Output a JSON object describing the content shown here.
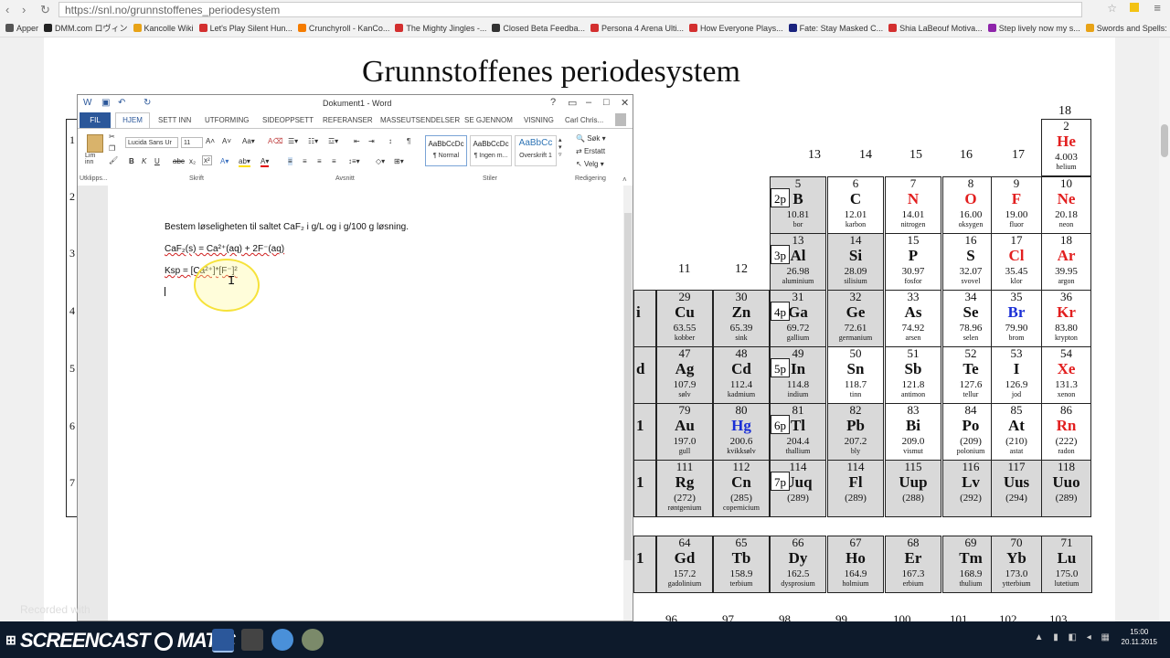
{
  "browser": {
    "url": "https://snl.no/grunnstoffenes_periodesystem",
    "bookmarks": [
      "Apper",
      "DMM.com ロヴィン",
      "Kancolle Wiki",
      "Let's Play Silent Hun...",
      "Crunchyroll - KanCo...",
      "The Mighty Jingles -...",
      "Closed Beta Feedba...",
      "Persona 4 Arena Ulti...",
      "How Everyone Plays...",
      "Fate: Stay Masked C...",
      "Shia LaBeouf Motiva...",
      "Step lively now my s...",
      "Swords and Spells: ..."
    ],
    "bookmark_colors": [
      "#555555",
      "#222222",
      "#e8a317",
      "#d32f2f",
      "#f57c00",
      "#d32f2f",
      "#333333",
      "#d32f2f",
      "#d32f2f",
      "#1a237e",
      "#d32f2f",
      "#8e24aa",
      "#e8a317"
    ]
  },
  "page": {
    "title": "Grunnstoffenes periodesystem",
    "group_numbers": {
      "g18": "18",
      "g13": "13",
      "g14": "14",
      "g15": "15",
      "g16": "16",
      "g17": "17",
      "g11": "11",
      "g12": "12"
    },
    "subshells": [
      "2p",
      "3p",
      "4p",
      "5p",
      "6p",
      "7p"
    ],
    "row_numbers": [
      "1",
      "2",
      "3",
      "4",
      "5",
      "6",
      "7"
    ],
    "elements": [
      {
        "n": "2",
        "s": "He",
        "m": "4.003",
        "name": "helium",
        "c": "red"
      },
      {
        "n": "5",
        "s": "B",
        "m": "10.81",
        "name": "bor",
        "c": ""
      },
      {
        "n": "6",
        "s": "C",
        "m": "12.01",
        "name": "karbon",
        "c": ""
      },
      {
        "n": "7",
        "s": "N",
        "m": "14.01",
        "name": "nitrogen",
        "c": "red"
      },
      {
        "n": "8",
        "s": "O",
        "m": "16.00",
        "name": "oksygen",
        "c": "red"
      },
      {
        "n": "9",
        "s": "F",
        "m": "19.00",
        "name": "fluor",
        "c": "red"
      },
      {
        "n": "10",
        "s": "Ne",
        "m": "20.18",
        "name": "neon",
        "c": "red"
      },
      {
        "n": "13",
        "s": "Al",
        "m": "26.98",
        "name": "aluminium",
        "c": ""
      },
      {
        "n": "14",
        "s": "Si",
        "m": "28.09",
        "name": "silisium",
        "c": ""
      },
      {
        "n": "15",
        "s": "P",
        "m": "30.97",
        "name": "fosfor",
        "c": ""
      },
      {
        "n": "16",
        "s": "S",
        "m": "32.07",
        "name": "svovel",
        "c": ""
      },
      {
        "n": "17",
        "s": "Cl",
        "m": "35.45",
        "name": "klor",
        "c": "red"
      },
      {
        "n": "18",
        "s": "Ar",
        "m": "39.95",
        "name": "argon",
        "c": "red"
      },
      {
        "n": "29",
        "s": "Cu",
        "m": "63.55",
        "name": "kobber",
        "c": ""
      },
      {
        "n": "30",
        "s": "Zn",
        "m": "65.39",
        "name": "sink",
        "c": ""
      },
      {
        "n": "31",
        "s": "Ga",
        "m": "69.72",
        "name": "gallium",
        "c": ""
      },
      {
        "n": "32",
        "s": "Ge",
        "m": "72.61",
        "name": "germanium",
        "c": ""
      },
      {
        "n": "33",
        "s": "As",
        "m": "74.92",
        "name": "arsen",
        "c": ""
      },
      {
        "n": "34",
        "s": "Se",
        "m": "78.96",
        "name": "selen",
        "c": ""
      },
      {
        "n": "35",
        "s": "Br",
        "m": "79.90",
        "name": "brom",
        "c": "blue"
      },
      {
        "n": "36",
        "s": "Kr",
        "m": "83.80",
        "name": "krypton",
        "c": "red"
      },
      {
        "n": "47",
        "s": "Ag",
        "m": "107.9",
        "name": "sølv",
        "c": ""
      },
      {
        "n": "48",
        "s": "Cd",
        "m": "112.4",
        "name": "kadmium",
        "c": ""
      },
      {
        "n": "49",
        "s": "In",
        "m": "114.8",
        "name": "indium",
        "c": ""
      },
      {
        "n": "50",
        "s": "Sn",
        "m": "118.7",
        "name": "tinn",
        "c": ""
      },
      {
        "n": "51",
        "s": "Sb",
        "m": "121.8",
        "name": "antimon",
        "c": ""
      },
      {
        "n": "52",
        "s": "Te",
        "m": "127.6",
        "name": "tellur",
        "c": ""
      },
      {
        "n": "53",
        "s": "I",
        "m": "126.9",
        "name": "jod",
        "c": ""
      },
      {
        "n": "54",
        "s": "Xe",
        "m": "131.3",
        "name": "xenon",
        "c": "red"
      },
      {
        "n": "79",
        "s": "Au",
        "m": "197.0",
        "name": "gull",
        "c": ""
      },
      {
        "n": "80",
        "s": "Hg",
        "m": "200.6",
        "name": "kvikksølv",
        "c": "blue"
      },
      {
        "n": "81",
        "s": "Tl",
        "m": "204.4",
        "name": "thallium",
        "c": ""
      },
      {
        "n": "82",
        "s": "Pb",
        "m": "207.2",
        "name": "bly",
        "c": ""
      },
      {
        "n": "83",
        "s": "Bi",
        "m": "209.0",
        "name": "vismut",
        "c": ""
      },
      {
        "n": "84",
        "s": "Po",
        "m": "(209)",
        "name": "polonium",
        "c": ""
      },
      {
        "n": "85",
        "s": "At",
        "m": "(210)",
        "name": "astat",
        "c": ""
      },
      {
        "n": "86",
        "s": "Rn",
        "m": "(222)",
        "name": "radon",
        "c": "red"
      },
      {
        "n": "111",
        "s": "Rg",
        "m": "(272)",
        "name": "røntgenium",
        "c": ""
      },
      {
        "n": "112",
        "s": "Cn",
        "m": "(285)",
        "name": "copernicium",
        "c": ""
      },
      {
        "n": "114",
        "s": "Uuq",
        "m": "(289)",
        "name": "",
        "c": ""
      },
      {
        "n": "114",
        "s": "Fl",
        "m": "(289)",
        "name": "",
        "c": ""
      },
      {
        "n": "115",
        "s": "Uup",
        "m": "(288)",
        "name": "",
        "c": ""
      },
      {
        "n": "116",
        "s": "Lv",
        "m": "(292)",
        "name": "",
        "c": ""
      },
      {
        "n": "117",
        "s": "Uus",
        "m": "(294)",
        "name": "",
        "c": ""
      },
      {
        "n": "118",
        "s": "Uuo",
        "m": "(289)",
        "name": "",
        "c": ""
      },
      {
        "n": "64",
        "s": "Gd",
        "m": "157.2",
        "name": "gadolinium",
        "c": ""
      },
      {
        "n": "65",
        "s": "Tb",
        "m": "158.9",
        "name": "terbium",
        "c": ""
      },
      {
        "n": "66",
        "s": "Dy",
        "m": "162.5",
        "name": "dysprosium",
        "c": ""
      },
      {
        "n": "67",
        "s": "Ho",
        "m": "164.9",
        "name": "holmium",
        "c": ""
      },
      {
        "n": "68",
        "s": "Er",
        "m": "167.3",
        "name": "erbium",
        "c": ""
      },
      {
        "n": "69",
        "s": "Tm",
        "m": "168.9",
        "name": "thulium",
        "c": ""
      },
      {
        "n": "70",
        "s": "Yb",
        "m": "173.0",
        "name": "ytterbium",
        "c": ""
      },
      {
        "n": "71",
        "s": "Lu",
        "m": "175.0",
        "name": "lutetium",
        "c": ""
      }
    ],
    "bottom_row_numbers": [
      "96",
      "97",
      "98",
      "99",
      "100",
      "101",
      "102",
      "103"
    ],
    "partial_letters": {
      "p4": "i",
      "p4b": "l",
      "p5": "d",
      "p5b": "ium",
      "p6": "1",
      "p7": "1",
      "p7b": "(289)",
      "pl": "1",
      "plb": "0"
    }
  },
  "word": {
    "title": "Dokument1 - Word",
    "user": "Carl Chris...",
    "tabs": {
      "file": "FIL",
      "home": "HJEM",
      "insert": "SETT INN",
      "design": "UTFORMING",
      "layout": "SIDEOPPSETT",
      "references": "REFERANSER",
      "mailings": "MASSEUTSENDELSER",
      "review": "SE GJENNOM",
      "view": "VISNING"
    },
    "ribbon": {
      "paste": "Lim inn",
      "font": "Lucida Sans Ur",
      "size": "11",
      "groups": {
        "clipboard": "Utklipps...",
        "font": "Skrift",
        "paragraph": "Avsnitt",
        "styles": "Stiler",
        "editing": "Redigering"
      },
      "styles": [
        {
          "preview": "AaBbCcDc",
          "label": "¶ Normal"
        },
        {
          "preview": "AaBbCcDc",
          "label": "¶ Ingen m..."
        },
        {
          "preview": "AaBbCc",
          "label": "Overskrift 1"
        }
      ],
      "editing": {
        "find": "Søk",
        "replace": "Erstatt",
        "select": "Velg"
      }
    },
    "doc": {
      "line1": "Bestem løseligheten til saltet CaF₂ i g/L og i g/100 g løsning.",
      "line2": "CaF₂(s) = Ca²⁺(aq) + 2F⁻(aq)",
      "line3": "Ksp = [Ca²⁺]*[F⁻]²"
    }
  },
  "taskbar": {
    "brand": "SCREENCAST",
    "brand2": "MATIC",
    "recorded": "Recorded with",
    "time": "15:00",
    "date": "20.11.2015"
  }
}
